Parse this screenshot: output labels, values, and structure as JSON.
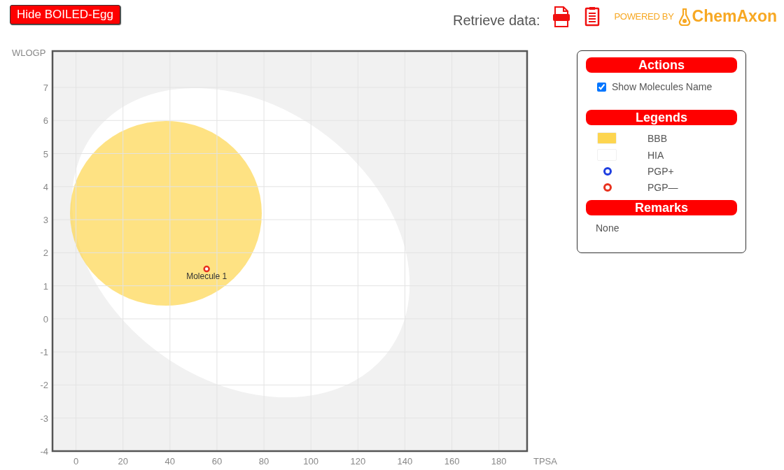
{
  "toolbar": {
    "toggle_button": "Hide BOILED-Egg",
    "retrieve_label": "Retrieve data:",
    "powered_by": "POWERED BY",
    "brand": "ChemAxon"
  },
  "chart": {
    "chart_data": {
      "type": "scatter",
      "grid": true,
      "xlabel": "TPSA",
      "ylabel": "WLOGP",
      "xlim": [
        -10,
        192
      ],
      "ylim": [
        -4,
        8.1
      ],
      "xticks": [
        0,
        20,
        40,
        60,
        80,
        100,
        120,
        140,
        160,
        180
      ],
      "yticks": [
        -4,
        -3,
        -2,
        -1,
        0,
        1,
        2,
        3,
        4,
        5,
        6,
        7
      ],
      "x": [
        55.6
      ],
      "series": [
        {
          "name": "Molecule 1",
          "color": "#e8321e",
          "values": [
            1.51
          ]
        }
      ]
    }
  },
  "panel": {
    "actions_title": "Actions",
    "show_names": {
      "label": "Show Molecules Name",
      "checked": true
    },
    "legends_title": "Legends",
    "legends": [
      {
        "kind": "swatch",
        "label": "BBB",
        "color": "#fdd54f"
      },
      {
        "kind": "swatch",
        "label": "HIA",
        "color": "#ffffff"
      },
      {
        "kind": "dot",
        "label": "PGP+",
        "color": "#1f3fe0"
      },
      {
        "kind": "dot",
        "label": "PGP—",
        "color": "#e8321e"
      }
    ],
    "remarks_title": "Remarks",
    "remarks": "None"
  }
}
